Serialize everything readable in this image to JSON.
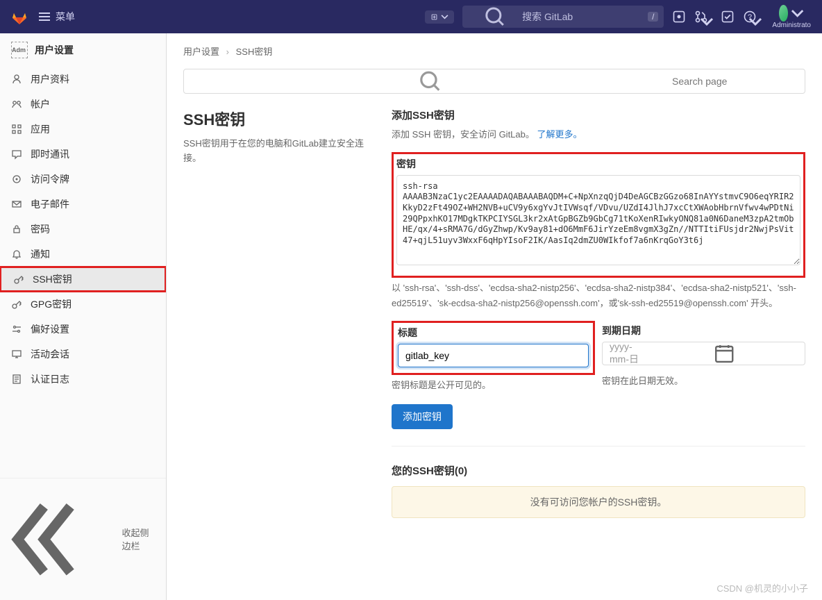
{
  "topbar": {
    "menu_label": "菜单",
    "search_placeholder": "搜索 GitLab",
    "search_shortcut": "/",
    "admin_label": "Administrato"
  },
  "sidebar": {
    "title": "用户设置",
    "avatar_text": "Adm",
    "items": [
      {
        "label": "用户资料",
        "icon": "user"
      },
      {
        "label": "帐户",
        "icon": "account"
      },
      {
        "label": "应用",
        "icon": "apps"
      },
      {
        "label": "即时通讯",
        "icon": "chat"
      },
      {
        "label": "访问令牌",
        "icon": "token"
      },
      {
        "label": "电子邮件",
        "icon": "email"
      },
      {
        "label": "密码",
        "icon": "lock"
      },
      {
        "label": "通知",
        "icon": "bell"
      },
      {
        "label": "SSH密钥",
        "icon": "key"
      },
      {
        "label": "GPG密钥",
        "icon": "key"
      },
      {
        "label": "偏好设置",
        "icon": "settings"
      },
      {
        "label": "活动会话",
        "icon": "monitor"
      },
      {
        "label": "认证日志",
        "icon": "log"
      }
    ],
    "collapse_label": "收起侧边栏"
  },
  "breadcrumb": {
    "root": "用户设置",
    "current": "SSH密钥"
  },
  "search_page_placeholder": "Search page",
  "left_panel": {
    "heading": "SSH密钥",
    "desc": "SSH密钥用于在您的电脑和GitLab建立安全连接。"
  },
  "form": {
    "add_heading": "添加SSH密钥",
    "add_desc_prefix": "添加 SSH 密钥，安全访问 GitLab。",
    "learn_more": "了解更多。",
    "key_label": "密钥",
    "key_value": "ssh-rsa AAAAB3NzaC1yc2EAAAADAQABAAABAQDM+C+NpXnzqQjD4DeAGCBzGGzo68InAYYstmvC9O6eqYRIR2KkyD2zFt49OZ+WH2NVB+uCV9y6xgYvJtIVWsqf/VDvu/UZdI4JlhJ7xcCtXWAobHbrnVfwv4wPDtNi29QPpxhKO17MDgkTKPCIYSGL3kr2xAtGpBGZb9GbCg71tKoXenRIwkyONQ81a0N6DaneM3zpA2tmObHE/qx/4+sRMA7G/dGyZhwp/Kv9ay81+dO6MmF6JirYzeEm8vgmX3gZn//NTTItiFUsjdr2NwjPsVit47+qjL51uyv3WxxF6qHpYIsoF2IK/AasIq2dmZU0WIkfof7a6nKrqGoY3t6j",
    "key_help": "以 'ssh-rsa'、'ssh-dss'、'ecdsa-sha2-nistp256'、'ecdsa-sha2-nistp384'、'ecdsa-sha2-nistp521'、'ssh-ed25519'、'sk-ecdsa-sha2-nistp256@openssh.com'，或'sk-ssh-ed25519@openssh.com' 开头。",
    "title_label": "标题",
    "title_value": "gitlab_key",
    "title_help": "密钥标题是公开可见的。",
    "expires_label": "到期日期",
    "expires_placeholder": "yyyy-mm-日",
    "expires_help": "密钥在此日期无效。",
    "submit_label": "添加密钥"
  },
  "list": {
    "heading": "您的SSH密钥(0)",
    "empty": "没有可访问您帐户的SSH密钥。"
  },
  "watermark": "CSDN @机灵的小小子"
}
